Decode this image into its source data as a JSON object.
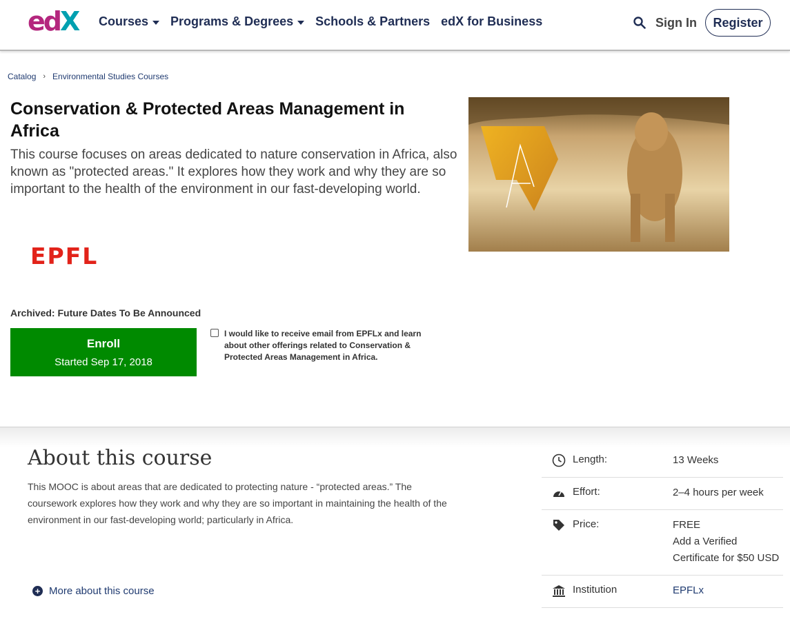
{
  "header": {
    "logo": {
      "e": "e",
      "d": "d",
      "x": "X"
    },
    "nav": [
      {
        "label": "Courses",
        "has_dropdown": true
      },
      {
        "label": "Programs & Degrees",
        "has_dropdown": true
      },
      {
        "label": "Schools & Partners",
        "has_dropdown": false
      },
      {
        "label": "edX for Business",
        "has_dropdown": false
      }
    ],
    "search_icon": "search-icon",
    "signin_label": "Sign In",
    "register_label": "Register"
  },
  "breadcrumb": {
    "items": [
      "Catalog",
      "Environmental Studies Courses"
    ],
    "separator": "›"
  },
  "course": {
    "title": "Conservation & Protected Areas Management in Africa",
    "description": "This course focuses on areas dedicated to nature conservation in Africa, also known as \"protected areas.\" It explores how they work and why they are so important to the health of the environment in our fast-developing world.",
    "school_logo_text": "EPFL",
    "status": "Archived: Future Dates To Be Announced",
    "enroll_label": "Enroll",
    "enroll_sub": "Started Sep 17, 2018",
    "optin_text": "I would like to receive email from EPFLx and learn about other offerings related to Conservation & Protected Areas Management in Africa."
  },
  "about": {
    "title": "About this course",
    "body": "This MOOC is about areas that are dedicated to protecting nature - “protected areas.” The coursework explores how they work and why they are so important in maintaining the health of the environment in our fast-developing world; particularly in Africa.",
    "more_label": "More about this course"
  },
  "facts": [
    {
      "icon": "clock-icon",
      "label": "Length:",
      "value": "13 Weeks"
    },
    {
      "icon": "gauge-icon",
      "label": "Effort:",
      "value": "2–4 hours per week"
    },
    {
      "icon": "tag-icon",
      "label": "Price:",
      "value": "FREE\nAdd a Verified Certificate for $50 USD"
    },
    {
      "icon": "institution-icon",
      "label": "Institution",
      "value": "EPFLx",
      "link": true
    }
  ],
  "colors": {
    "brand_navy": "#1f2d54",
    "enroll_green": "#008a00",
    "epfl_red": "#e2231a",
    "logo_magenta": "#b4277e",
    "logo_teal": "#00a0b0"
  }
}
